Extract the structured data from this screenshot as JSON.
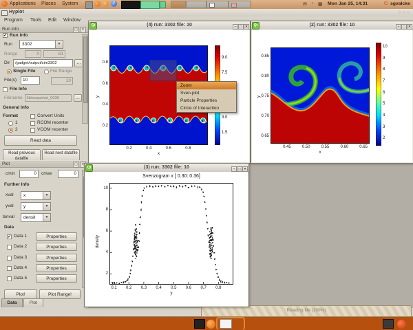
{
  "panel": {
    "menus": [
      "Applications",
      "Places",
      "System"
    ],
    "clock": "Mon Jan 25, 14:31",
    "user": "sgvalcke"
  },
  "app": {
    "window_title": "Hyplot",
    "menubar": [
      "Program",
      "Tools",
      "Edit",
      "Window"
    ],
    "run_dock": {
      "title": "Run info",
      "group_label": "Run Info",
      "run_label": "Run",
      "run_value": "3302",
      "range_label": "Range",
      "range_min": "0",
      "range_max": "81",
      "dir_label": "Dir",
      "dir_value": "/gadget/output/sim3302",
      "browse_label": "...",
      "single_file_label": "Single File",
      "file_range_label": "File Range",
      "files_label": "File(s)",
      "files_value": "10",
      "files_value2": "10",
      "file_info_label": "File Info",
      "filename_label": "Filename",
      "filename_value": "lib/snapshot_0036",
      "general_info_label": "General Info",
      "format_label": "Format",
      "format_1": "1",
      "format_2": "2",
      "convert_units": "Convert Units",
      "rcom": "RCOM recenter",
      "vcom": "VCOM recenter",
      "read_data": "Read data",
      "read_prev": "Read previous datafile",
      "read_next": "Read next datafile"
    },
    "plot_dock": {
      "title": "Plot",
      "cmin_label": "cmin",
      "cmin_value": "0",
      "cmax_label": "cmax",
      "cmax_value": "0",
      "further_info_label": "Further Info",
      "xval_label": "xval",
      "xval_value": "x",
      "yval_label": "yval",
      "yval_value": "y",
      "binval_label": "binval",
      "binval_value": "densit",
      "data_label": "Data",
      "properties_label": "Properties",
      "data_rows": [
        {
          "label": "Data 1",
          "checked": true
        },
        {
          "label": "Data 2",
          "checked": false
        },
        {
          "label": "Data 3",
          "checked": false
        },
        {
          "label": "Data 4",
          "checked": false
        },
        {
          "label": "Data 5",
          "checked": false
        }
      ],
      "plot_btn": "Plot!",
      "plot_range_btn": "Plot Range!"
    },
    "tabs": [
      "Data",
      "Plot"
    ],
    "status_text": "Reading file (100%)"
  },
  "context_menu": {
    "items": [
      "Zoom",
      "Sven-plot",
      "Particle Properties",
      "Circle of Interaction"
    ],
    "highlighted": "Zoom"
  },
  "chart_data": [
    {
      "id": "win4",
      "type": "heatmap",
      "window_title": "(4) run: 3302 file: 10",
      "xlabel": "x",
      "ylabel": "y",
      "xlim": [
        0.0,
        1.0
      ],
      "ylim": [
        0.02,
        0.96
      ],
      "xticks": [
        "0.2",
        "0.4",
        "0.6",
        "0.8"
      ],
      "yticks": [
        "0.2",
        "0.4",
        "0.6",
        "0.8"
      ],
      "colorbar": {
        "lim": [
          0.3,
          10.2
        ],
        "ticks": [
          "9.0",
          "7.5",
          "3.0",
          "1.5"
        ],
        "palette": "jet"
      },
      "content": "Kelvin-Helmholtz density slice: red band 0.25<y<0.75, blue outside, vortex rolls on both interfaces",
      "zoom_selection": {
        "x": [
          0.42,
          0.68
        ],
        "y": [
          0.63,
          0.81
        ]
      }
    },
    {
      "id": "win2",
      "type": "heatmap",
      "window_title": "(2) run: 3302 file: 10",
      "xlabel": "x",
      "ylabel": "y",
      "xlim": [
        0.407,
        0.666
      ],
      "ylim": [
        0.631,
        0.872
      ],
      "xticks": [
        "0.45",
        "0.50",
        "0.55",
        "0.60",
        "0.65"
      ],
      "yticks": [
        "0.65",
        "0.70",
        "0.75",
        "0.80",
        "0.85"
      ],
      "colorbar": {
        "lim": [
          1.35,
          10.35
        ],
        "ticks": [
          "10",
          "9",
          "8",
          "7",
          "6",
          "5",
          "4",
          "3",
          "2"
        ],
        "palette": "jet"
      },
      "content": "Zoomed Kelvin-Helmholtz vortex pair: blue upper region with green-yellow swirls, red lower region"
    },
    {
      "id": "win3",
      "type": "scatter",
      "window_title": "(3) run: 3302 file: 10",
      "title": "Svenzogram x [ 0.30: 0.36]",
      "xlabel": "y",
      "ylabel": "density",
      "xlim": [
        0.07,
        0.9
      ],
      "ylim": [
        1.0,
        10.5
      ],
      "xticks": [
        "0.1",
        "0.2",
        "0.3",
        "0.4",
        "0.5",
        "0.6",
        "0.7",
        "0.8"
      ],
      "yticks": [
        "2",
        "4",
        "6",
        "8",
        "10"
      ],
      "curve": [
        [
          0.09,
          1.15
        ],
        [
          0.105,
          1.15
        ],
        [
          0.12,
          1.16
        ],
        [
          0.135,
          1.17
        ],
        [
          0.15,
          1.18
        ],
        [
          0.165,
          1.2
        ],
        [
          0.178,
          1.25
        ],
        [
          0.188,
          1.35
        ],
        [
          0.196,
          1.5
        ],
        [
          0.203,
          1.7
        ],
        [
          0.209,
          2.0
        ],
        [
          0.214,
          2.35
        ],
        [
          0.219,
          2.75
        ],
        [
          0.223,
          3.2
        ],
        [
          0.227,
          3.7
        ],
        [
          0.231,
          4.3
        ],
        [
          0.235,
          4.9
        ],
        [
          0.239,
          5.5
        ],
        [
          0.243,
          6.1
        ],
        [
          0.247,
          6.6
        ],
        [
          0.25,
          6.2
        ],
        [
          0.253,
          5.6
        ],
        [
          0.256,
          5.0
        ],
        [
          0.259,
          4.5
        ],
        [
          0.262,
          4.2
        ],
        [
          0.265,
          4.5
        ],
        [
          0.268,
          5.1
        ],
        [
          0.271,
          5.8
        ],
        [
          0.274,
          6.6
        ],
        [
          0.277,
          7.3
        ],
        [
          0.281,
          8.0
        ],
        [
          0.285,
          8.7
        ],
        [
          0.29,
          9.3
        ],
        [
          0.296,
          9.8
        ],
        [
          0.303,
          10.05
        ],
        [
          0.32,
          10.15
        ],
        [
          0.34,
          10.2
        ],
        [
          0.36,
          10.1
        ],
        [
          0.38,
          10.2
        ],
        [
          0.4,
          10.15
        ],
        [
          0.42,
          10.2
        ],
        [
          0.44,
          10.1
        ],
        [
          0.46,
          10.2
        ],
        [
          0.48,
          10.15
        ],
        [
          0.5,
          10.2
        ],
        [
          0.52,
          10.1
        ],
        [
          0.54,
          10.2
        ],
        [
          0.56,
          10.15
        ],
        [
          0.58,
          10.2
        ],
        [
          0.6,
          10.1
        ],
        [
          0.62,
          10.2
        ],
        [
          0.64,
          10.15
        ],
        [
          0.66,
          10.1
        ],
        [
          0.675,
          10.05
        ],
        [
          0.688,
          9.9
        ],
        [
          0.697,
          9.6
        ],
        [
          0.704,
          9.2
        ],
        [
          0.71,
          8.7
        ],
        [
          0.715,
          8.1
        ],
        [
          0.72,
          7.4
        ],
        [
          0.724,
          6.8
        ],
        [
          0.728,
          6.2
        ],
        [
          0.732,
          5.6
        ],
        [
          0.736,
          5.0
        ],
        [
          0.74,
          4.5
        ],
        [
          0.744,
          4.2
        ],
        [
          0.748,
          4.5
        ],
        [
          0.752,
          5.1
        ],
        [
          0.755,
          5.8
        ],
        [
          0.758,
          6.3
        ],
        [
          0.761,
          5.8
        ],
        [
          0.764,
          5.2
        ],
        [
          0.768,
          4.6
        ],
        [
          0.772,
          4.0
        ],
        [
          0.776,
          3.4
        ],
        [
          0.781,
          2.9
        ],
        [
          0.786,
          2.4
        ],
        [
          0.792,
          2.0
        ],
        [
          0.799,
          1.7
        ],
        [
          0.807,
          1.45
        ],
        [
          0.816,
          1.3
        ],
        [
          0.827,
          1.22
        ],
        [
          0.84,
          1.17
        ],
        [
          0.855,
          1.15
        ],
        [
          0.87,
          1.15
        ]
      ],
      "blobs": [
        {
          "cx": 0.247,
          "cy": 4.8,
          "rx": 0.012,
          "ry": 1.5,
          "n": 70
        },
        {
          "cx": 0.75,
          "cy": 4.9,
          "rx": 0.012,
          "ry": 1.5,
          "n": 70
        }
      ]
    }
  ]
}
